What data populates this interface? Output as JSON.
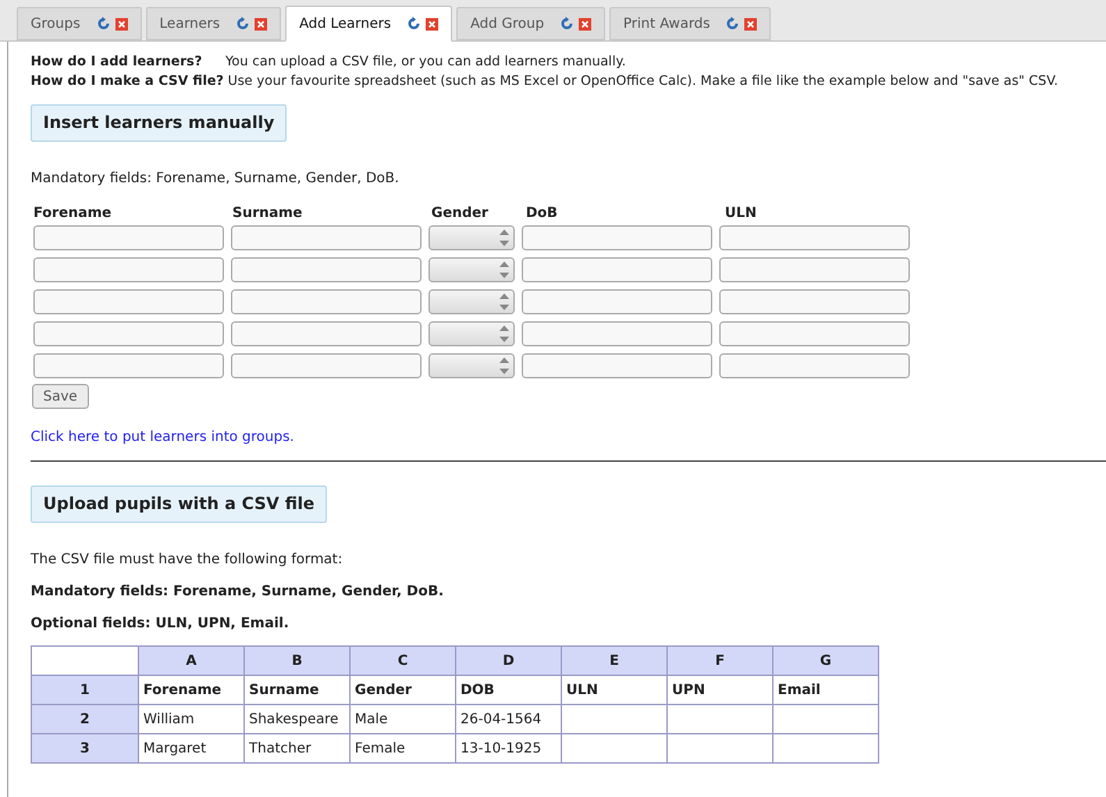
{
  "tabs": [
    {
      "label": "Groups",
      "selected": false
    },
    {
      "label": "Learners",
      "selected": false
    },
    {
      "label": "Add Learners",
      "selected": true
    },
    {
      "label": "Add Group",
      "selected": false
    },
    {
      "label": "Print Awards",
      "selected": false
    }
  ],
  "intro": [
    {
      "question": "How do I add learners?",
      "answer": "You can upload a CSV file, or you can add learners manually."
    },
    {
      "question": "How do I make a CSV file?",
      "answer": "Use your favourite spreadsheet (such as MS Excel or OpenOffice Calc). Make a file like the example below and \"save as\" CSV."
    }
  ],
  "manual_section": {
    "heading": "Insert learners manually",
    "note": "Mandatory fields: Forename, Surname, Gender, DoB.",
    "columns": [
      {
        "label": "Forename",
        "kind": "text"
      },
      {
        "label": "Surname",
        "kind": "text"
      },
      {
        "label": "Gender",
        "kind": "select"
      },
      {
        "label": "DoB",
        "kind": "text"
      },
      {
        "label": "ULN",
        "kind": "text"
      }
    ],
    "rows": [
      {
        "kind": "blank"
      },
      {
        "kind": "blank"
      },
      {
        "kind": "blank"
      },
      {
        "kind": "blank"
      },
      {
        "kind": "blank"
      }
    ],
    "save_button": "Save",
    "groups_link": "Click here to put learners into groups."
  },
  "csv_section": {
    "heading": "Upload pupils with a CSV file",
    "note": "The CSV file must have the following format:",
    "mandatory": "Mandatory fields: Forename, Surname, Gender, DoB.",
    "optional": "Optional fields: ULN, UPN, Email.",
    "spreadsheet": {
      "column_letters": [
        "A",
        "B",
        "C",
        "D",
        "E",
        "F",
        "G"
      ],
      "rows": [
        {
          "number": "1",
          "kind": "header",
          "cells": [
            "Forename",
            "Surname",
            "Gender",
            "DOB",
            "ULN",
            "UPN",
            "Email"
          ]
        },
        {
          "number": "2",
          "kind": "data",
          "cells": [
            "William",
            "Shakespeare",
            "Male",
            "26-04-1564",
            "",
            "",
            ""
          ]
        },
        {
          "number": "3",
          "kind": "data",
          "cells": [
            "Margaret",
            "Thatcher",
            "Female",
            "13-10-1925",
            "",
            "",
            ""
          ]
        }
      ]
    }
  }
}
